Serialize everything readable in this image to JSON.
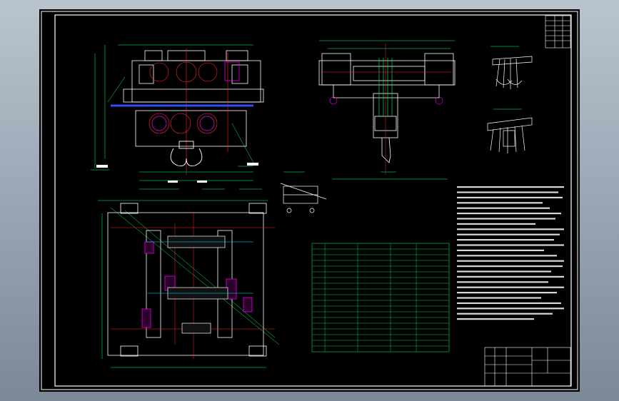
{
  "drawing": {
    "top_right_label": "",
    "notes_header": "",
    "table_header": "",
    "title_block": {
      "drawing_name": "",
      "scale": ""
    }
  },
  "colors": {
    "background": "#000000",
    "border": "#ffffff",
    "geometry": "#ffffff",
    "dimension": "#00ff66",
    "center_line": "#ff2a2a",
    "highlight": "#ff00ff",
    "axis_blue": "#2d4dff",
    "cyan": "#00e5ff"
  },
  "views": [
    {
      "id": "front-view"
    },
    {
      "id": "side-view"
    },
    {
      "id": "top-view"
    },
    {
      "id": "detail-a"
    },
    {
      "id": "pulley-detail-1"
    },
    {
      "id": "pulley-detail-2"
    },
    {
      "id": "parameter-table"
    },
    {
      "id": "technical-notes"
    },
    {
      "id": "title-block"
    }
  ]
}
